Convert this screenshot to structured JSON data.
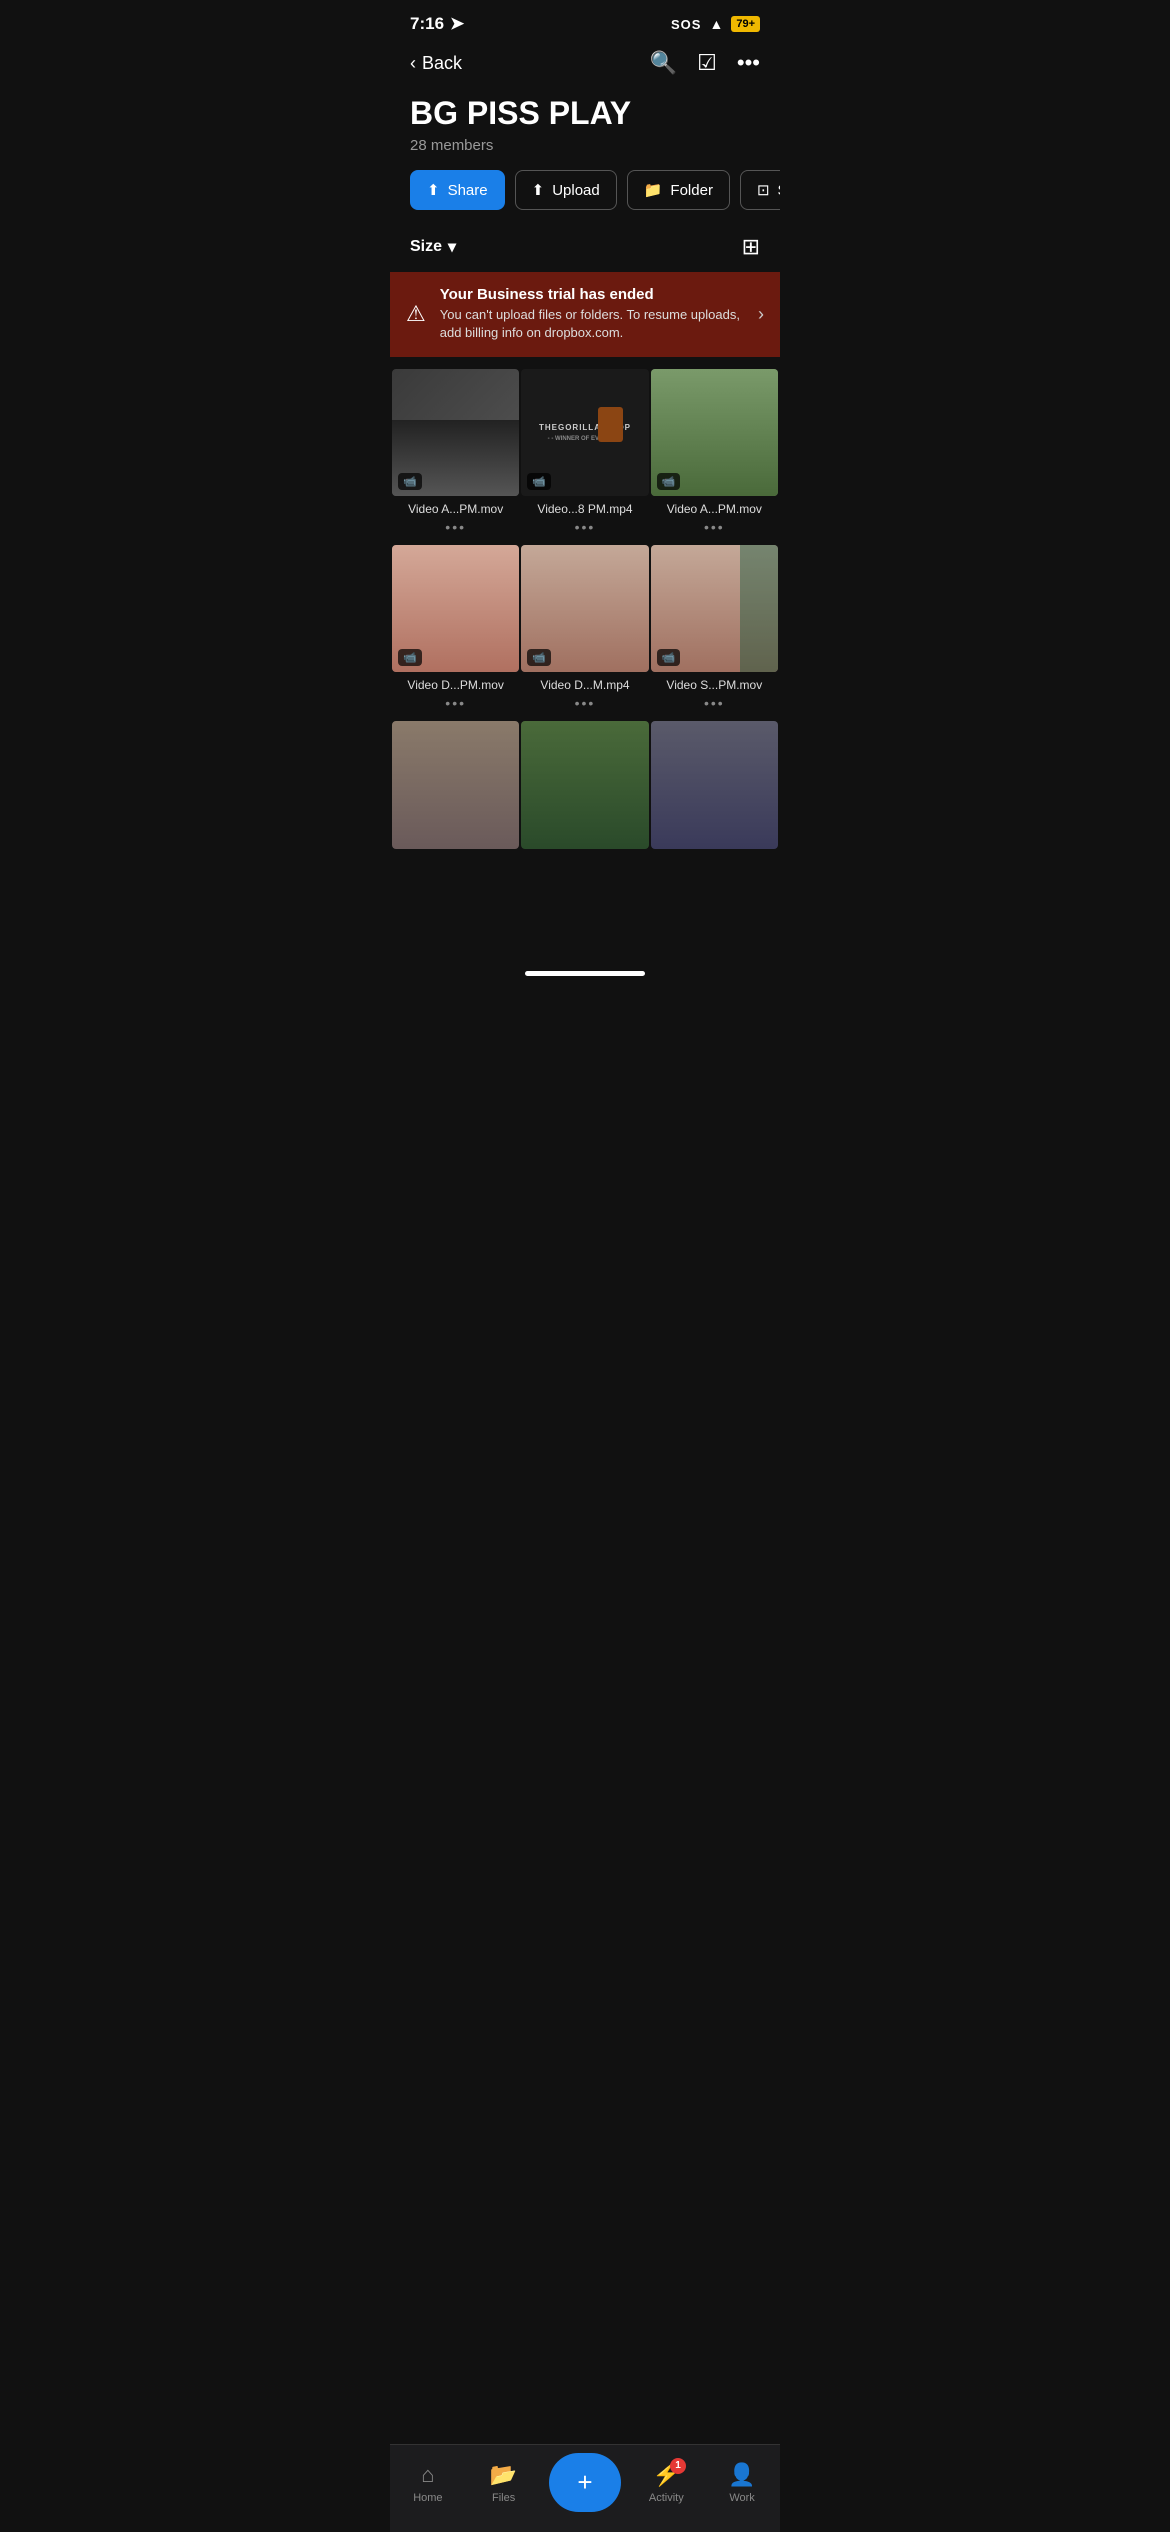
{
  "statusBar": {
    "time": "7:16",
    "sos": "SOS",
    "battery": "79"
  },
  "nav": {
    "backLabel": "Back"
  },
  "folder": {
    "title": "BG PISS PLAY",
    "members": "28 members"
  },
  "actionButtons": [
    {
      "id": "share",
      "label": "Share",
      "icon": "↑",
      "active": true
    },
    {
      "id": "upload",
      "label": "Upload",
      "icon": "⬆",
      "active": false
    },
    {
      "id": "folder",
      "label": "Folder",
      "icon": "📁",
      "active": false
    },
    {
      "id": "scan",
      "label": "Scan",
      "icon": "⊡",
      "active": false
    }
  ],
  "sort": {
    "label": "Size",
    "chevron": "▾"
  },
  "banner": {
    "title": "Your Business trial has ended",
    "subtitle": "You can't upload files or folders. To resume uploads, add billing info on dropbox.com."
  },
  "files": [
    {
      "id": 1,
      "name": "Video A...PM.mov",
      "type": "video",
      "thumbClass": "thumb-1"
    },
    {
      "id": 2,
      "name": "Video...8 PM.mp4",
      "type": "video",
      "thumbClass": "thumb-2",
      "hasOverlay": true
    },
    {
      "id": 3,
      "name": "Video A...PM.mov",
      "type": "video",
      "thumbClass": "thumb-3"
    },
    {
      "id": 4,
      "name": "Video D...PM.mov",
      "type": "video",
      "thumbClass": "thumb-4"
    },
    {
      "id": 5,
      "name": "Video D...M.mp4",
      "type": "video",
      "thumbClass": "thumb-5"
    },
    {
      "id": 6,
      "name": "Video S...PM.mov",
      "type": "video",
      "thumbClass": "thumb-6"
    },
    {
      "id": 7,
      "name": "",
      "type": "video",
      "thumbClass": "thumb-7"
    },
    {
      "id": 8,
      "name": "",
      "type": "video",
      "thumbClass": "thumb-8"
    },
    {
      "id": 9,
      "name": "",
      "type": "video",
      "thumbClass": "thumb-9"
    }
  ],
  "tabs": [
    {
      "id": "home",
      "label": "Home",
      "icon": "⌂",
      "badge": null
    },
    {
      "id": "files",
      "label": "Files",
      "icon": "📂",
      "badge": null
    },
    {
      "id": "add",
      "label": "",
      "icon": "+",
      "badge": null
    },
    {
      "id": "activity",
      "label": "Activity",
      "icon": "⚡",
      "badge": "1"
    },
    {
      "id": "work",
      "label": "Work",
      "icon": "👤",
      "badge": null
    }
  ]
}
